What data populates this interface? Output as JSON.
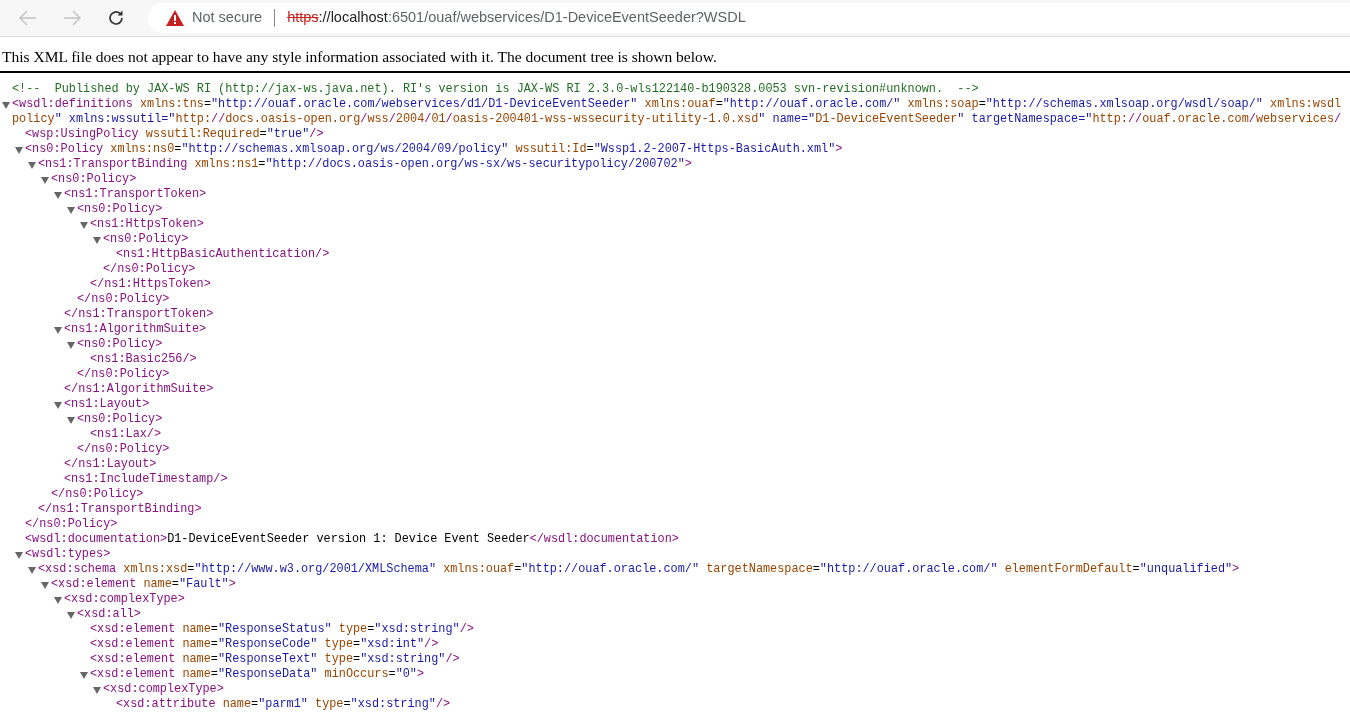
{
  "browser": {
    "back_button": {
      "disabled": true
    },
    "forward_button": {
      "disabled": true
    },
    "address_bar": {
      "secure": false,
      "security_label": "Not secure",
      "url_scheme": "https",
      "url_host": "://localhost",
      "url_path": ":6501/ouaf/webservices/D1-DeviceEventSeeder?WSDL"
    }
  },
  "notice": "This XML file does not appear to have any style information associated with it. The document tree is shown below.",
  "tree": [
    {
      "kind": "comment",
      "text": "<!--  Published by JAX-WS RI (http://jax-ws.java.net). RI's version is JAX-WS RI 2.3.0-wls122140-b190328.0053 svn-revision#unknown.  -->"
    },
    {
      "kind": "element",
      "expanded": true,
      "open": [
        "<wsdl:definitions xmlns:tns=\"http://ouaf.oracle.com/webservices/d1/D1-DeviceEventSeeder\" xmlns:ouaf=\"http://ouaf.oracle.com/\" xmlns:soap=\"http://schemas.xmlsoap.org/wsdl/soap/\" xmlns:wsdl",
        "policy\" xmlns:wssutil=\"http://docs.oasis-open.org/wss/2004/01/oasis-200401-wss-wssecurity-utility-1.0.xsd\" name=\"D1-DeviceEventSeeder\" targetNamespace=\"http://ouaf.oracle.com/webservices/"
      ],
      "children": [
        {
          "kind": "leaf",
          "text": "<wsp:UsingPolicy wssutil:Required=\"true\"/>"
        },
        {
          "kind": "element",
          "expanded": true,
          "open": [
            "<ns0:Policy xmlns:ns0=\"http://schemas.xmlsoap.org/ws/2004/09/policy\" wssutil:Id=\"Wssp1.2-2007-Https-BasicAuth.xml\">"
          ],
          "close": "</ns0:Policy>",
          "children": [
            {
              "kind": "element",
              "expanded": true,
              "open": [
                "<ns1:TransportBinding xmlns:ns1=\"http://docs.oasis-open.org/ws-sx/ws-securitypolicy/200702\">"
              ],
              "close": "</ns1:TransportBinding>",
              "children": [
                {
                  "kind": "element",
                  "expanded": true,
                  "open": [
                    "<ns0:Policy>"
                  ],
                  "close": "</ns0:Policy>",
                  "children": [
                    {
                      "kind": "element",
                      "expanded": true,
                      "open": [
                        "<ns1:TransportToken>"
                      ],
                      "close": "</ns1:TransportToken>",
                      "children": [
                        {
                          "kind": "element",
                          "expanded": true,
                          "open": [
                            "<ns0:Policy>"
                          ],
                          "close": "</ns0:Policy>",
                          "children": [
                            {
                              "kind": "element",
                              "expanded": true,
                              "open": [
                                "<ns1:HttpsToken>"
                              ],
                              "close": "</ns1:HttpsToken>",
                              "children": [
                                {
                                  "kind": "element",
                                  "expanded": true,
                                  "open": [
                                    "<ns0:Policy>"
                                  ],
                                  "close": "</ns0:Policy>",
                                  "children": [
                                    {
                                      "kind": "leaf",
                                      "text": "<ns1:HttpBasicAuthentication/>"
                                    }
                                  ]
                                }
                              ]
                            }
                          ]
                        }
                      ]
                    },
                    {
                      "kind": "element",
                      "expanded": true,
                      "open": [
                        "<ns1:AlgorithmSuite>"
                      ],
                      "close": "</ns1:AlgorithmSuite>",
                      "children": [
                        {
                          "kind": "element",
                          "expanded": true,
                          "open": [
                            "<ns0:Policy>"
                          ],
                          "close": "</ns0:Policy>",
                          "children": [
                            {
                              "kind": "leaf",
                              "text": "<ns1:Basic256/>"
                            }
                          ]
                        }
                      ]
                    },
                    {
                      "kind": "element",
                      "expanded": true,
                      "open": [
                        "<ns1:Layout>"
                      ],
                      "close": "</ns1:Layout>",
                      "children": [
                        {
                          "kind": "element",
                          "expanded": true,
                          "open": [
                            "<ns0:Policy>"
                          ],
                          "close": "</ns0:Policy>",
                          "children": [
                            {
                              "kind": "leaf",
                              "text": "<ns1:Lax/>"
                            }
                          ]
                        }
                      ]
                    },
                    {
                      "kind": "leaf",
                      "text": "<ns1:IncludeTimestamp/>"
                    }
                  ]
                }
              ]
            }
          ]
        },
        {
          "kind": "leaf",
          "text": "<wsdl:documentation>D1-DeviceEventSeeder version 1: Device Event Seeder</wsdl:documentation>"
        },
        {
          "kind": "element",
          "expanded": true,
          "open": [
            "<wsdl:types>"
          ],
          "children": [
            {
              "kind": "element",
              "expanded": true,
              "open": [
                "<xsd:schema xmlns:xsd=\"http://www.w3.org/2001/XMLSchema\" xmlns:ouaf=\"http://ouaf.oracle.com/\" targetNamespace=\"http://ouaf.oracle.com/\" elementFormDefault=\"unqualified\">"
              ],
              "children": [
                {
                  "kind": "element",
                  "expanded": true,
                  "open": [
                    "<xsd:element name=\"Fault\">"
                  ],
                  "children": [
                    {
                      "kind": "element",
                      "expanded": true,
                      "open": [
                        "<xsd:complexType>"
                      ],
                      "children": [
                        {
                          "kind": "element",
                          "expanded": true,
                          "open": [
                            "<xsd:all>"
                          ],
                          "children": [
                            {
                              "kind": "leaf",
                              "text": "<xsd:element name=\"ResponseStatus\" type=\"xsd:string\"/>"
                            },
                            {
                              "kind": "leaf",
                              "text": "<xsd:element name=\"ResponseCode\" type=\"xsd:int\"/>"
                            },
                            {
                              "kind": "leaf",
                              "text": "<xsd:element name=\"ResponseText\" type=\"xsd:string\"/>"
                            },
                            {
                              "kind": "element",
                              "expanded": true,
                              "open": [
                                "<xsd:element name=\"ResponseData\" minOccurs=\"0\">"
                              ],
                              "children": [
                                {
                                  "kind": "element",
                                  "expanded": true,
                                  "open": [
                                    "<xsd:complexType>"
                                  ],
                                  "children": [
                                    {
                                      "kind": "leaf",
                                      "text": "<xsd:attribute name=\"parm1\" type=\"xsd:string\"/>"
                                    }
                                  ]
                                }
                              ]
                            }
                          ]
                        }
                      ]
                    }
                  ]
                }
              ]
            }
          ]
        }
      ]
    }
  ]
}
